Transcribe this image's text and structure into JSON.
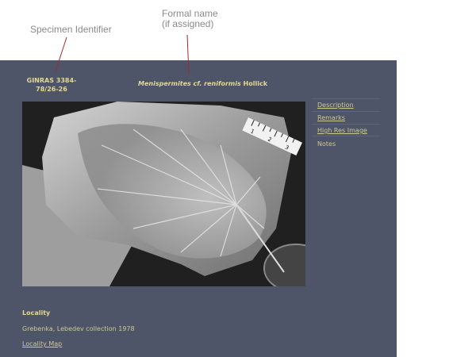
{
  "annotations": {
    "specimen_identifier": "Specimen Identifier",
    "formal_name_line1": "Formal name",
    "formal_name_line2": "(if assigned)"
  },
  "specimen": {
    "id_line1": "GINRAS 3384-",
    "id_line2": "78/26-26",
    "formal_name_italic": "Menispermites cf. reniformis",
    "formal_name_author": "Hollick"
  },
  "nav": {
    "items": [
      {
        "label": "Description"
      },
      {
        "label": "Remarks"
      },
      {
        "label": "High Res Image"
      }
    ],
    "notes": "Notes"
  },
  "locality": {
    "heading": "Locality",
    "text": "Grebenka, Lebedev collection 1978",
    "map_link": "Locality Map"
  },
  "photo": {
    "scale_numbers": [
      "1",
      "2",
      "3"
    ]
  },
  "colors": {
    "panel_bg": "#4e5568",
    "accent_text": "#e2d98f",
    "annotation_text": "#8a8a8a"
  }
}
